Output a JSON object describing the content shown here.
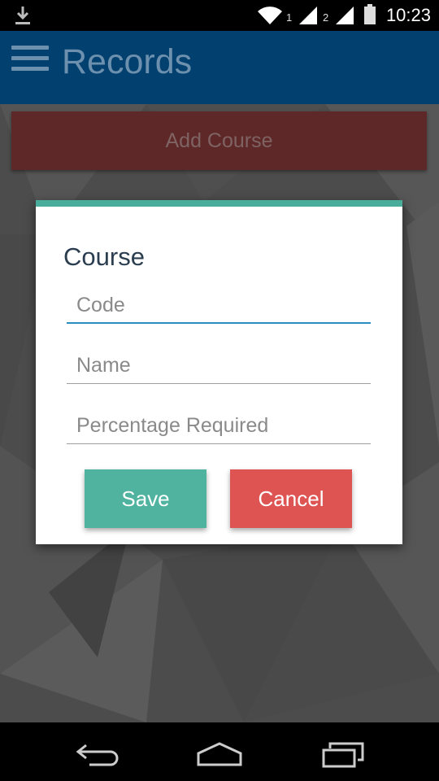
{
  "status_bar": {
    "time": "10:23",
    "sim1": "1",
    "sim2": "2",
    "icons": [
      "download-icon",
      "wifi-icon",
      "signal-icon",
      "battery-icon"
    ]
  },
  "app_bar": {
    "title": "Records",
    "menu_icon": "menu-icon",
    "color": "#02416f"
  },
  "main": {
    "add_course_label": "Add Course"
  },
  "dialog": {
    "title": "Course",
    "accent_color": "#4aac9a",
    "fields": {
      "code": {
        "placeholder": "Code",
        "value": ""
      },
      "name": {
        "placeholder": "Name",
        "value": ""
      },
      "percentage": {
        "placeholder": "Percentage Required",
        "value": ""
      }
    },
    "save_label": "Save",
    "cancel_label": "Cancel",
    "save_color": "#4fb39f",
    "cancel_color": "#de5452"
  },
  "nav_bar": {
    "icons": [
      "back-icon",
      "home-icon",
      "recents-icon"
    ]
  }
}
